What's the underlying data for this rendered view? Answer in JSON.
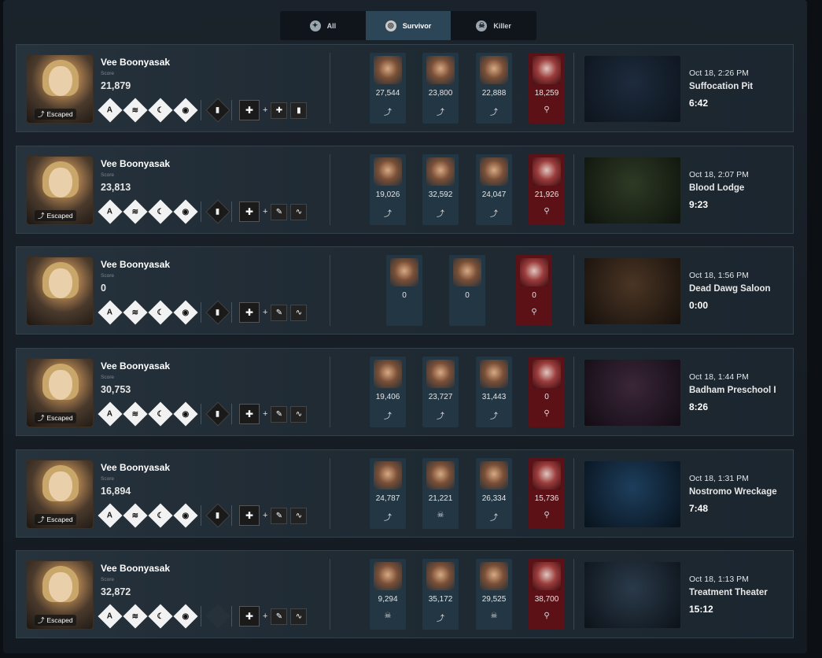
{
  "tabs": [
    {
      "label": "All",
      "icon": "palette-icon"
    },
    {
      "label": "Survivor",
      "icon": "survivor-icon",
      "active": true
    },
    {
      "label": "Killer",
      "icon": "killer-skull-icon"
    }
  ],
  "matches": [
    {
      "name": "Vee Boonyasak",
      "score_label": "Score",
      "score": "21,879",
      "status": "Escaped",
      "date": "Oct 18, 2:26 PM",
      "map": "Suffocation Pit",
      "duration": "6:42",
      "perks": [
        "A",
        "≋",
        "☾",
        "◉"
      ],
      "item_empty": false,
      "addons": [
        "✚",
        "▮"
      ],
      "map_colors": [
        "#1d2b3d",
        "#0d141c"
      ],
      "players": [
        {
          "score": "27,544",
          "status": "escaped-icon",
          "glyph": "⤴"
        },
        {
          "score": "23,800",
          "status": "escaped-icon",
          "glyph": "⤴"
        },
        {
          "score": "22,888",
          "status": "escaped-icon",
          "glyph": "⤴"
        },
        {
          "score": "18,259",
          "status": "hook-icon",
          "glyph": "⚲",
          "killer": true
        }
      ]
    },
    {
      "name": "Vee Boonyasak",
      "score_label": "Score",
      "score": "23,813",
      "status": "Escaped",
      "date": "Oct 18, 2:07 PM",
      "map": "Blood Lodge",
      "duration": "9:23",
      "perks": [
        "A",
        "≋",
        "☾",
        "◉"
      ],
      "item_empty": false,
      "addons": [
        "✎",
        "∿"
      ],
      "map_colors": [
        "#2e3a25",
        "#0e130c"
      ],
      "players": [
        {
          "score": "19,026",
          "status": "escaped-icon",
          "glyph": "⤴"
        },
        {
          "score": "32,592",
          "status": "escaped-icon",
          "glyph": "⤴"
        },
        {
          "score": "24,047",
          "status": "escaped-icon",
          "glyph": "⤴"
        },
        {
          "score": "21,926",
          "status": "hook-icon",
          "glyph": "⚲",
          "killer": true
        }
      ]
    },
    {
      "name": "Vee Boonyasak",
      "score_label": "Score",
      "score": "0",
      "status": "",
      "date": "Oct 18, 1:56 PM",
      "map": "Dead Dawg Saloon",
      "duration": "0:00",
      "perks": [
        "A",
        "≋",
        "☾",
        "◉"
      ],
      "item_empty": false,
      "addons": [
        "✎",
        "∿"
      ],
      "map_colors": [
        "#4a3524",
        "#16100b"
      ],
      "players": [
        {
          "score": "0",
          "status": "",
          "glyph": ""
        },
        {
          "score": "0",
          "status": "",
          "glyph": ""
        },
        {
          "score": "0",
          "status": "hook-icon",
          "glyph": "⚲",
          "killer": true
        }
      ]
    },
    {
      "name": "Vee Boonyasak",
      "score_label": "Score",
      "score": "30,753",
      "status": "Escaped",
      "date": "Oct 18, 1:44 PM",
      "map": "Badham Preschool I",
      "duration": "8:26",
      "perks": [
        "A",
        "≋",
        "☾",
        "◉"
      ],
      "item_empty": false,
      "addons": [
        "✎",
        "∿"
      ],
      "map_colors": [
        "#3a2638",
        "#120c14"
      ],
      "players": [
        {
          "score": "19,406",
          "status": "escaped-icon",
          "glyph": "⤴"
        },
        {
          "score": "23,727",
          "status": "escaped-icon",
          "glyph": "⤴"
        },
        {
          "score": "31,443",
          "status": "escaped-icon",
          "glyph": "⤴"
        },
        {
          "score": "0",
          "status": "hook-icon",
          "glyph": "⚲",
          "killer": true
        }
      ]
    },
    {
      "name": "Vee Boonyasak",
      "score_label": "Score",
      "score": "16,894",
      "status": "Escaped",
      "date": "Oct 18, 1:31 PM",
      "map": "Nostromo Wreckage",
      "duration": "7:48",
      "perks": [
        "A",
        "≋",
        "☾",
        "◉"
      ],
      "item_empty": false,
      "addons": [
        "✎",
        "∿"
      ],
      "map_colors": [
        "#1d3e5c",
        "#08121c"
      ],
      "players": [
        {
          "score": "24,787",
          "status": "escaped-icon",
          "glyph": "⤴"
        },
        {
          "score": "21,221",
          "status": "skull-icon",
          "glyph": "☠"
        },
        {
          "score": "26,334",
          "status": "escaped-icon",
          "glyph": "⤴"
        },
        {
          "score": "15,736",
          "status": "hook-icon",
          "glyph": "⚲",
          "killer": true
        }
      ]
    },
    {
      "name": "Vee Boonyasak",
      "score_label": "Score",
      "score": "32,872",
      "status": "Escaped",
      "date": "Oct 18, 1:13 PM",
      "map": "Treatment Theater",
      "duration": "15:12",
      "perks": [
        "A",
        "≋",
        "☾",
        "◉"
      ],
      "item_empty": true,
      "addons": [
        "✎",
        "∿"
      ],
      "map_colors": [
        "#2a3a4a",
        "#0c1218"
      ],
      "players": [
        {
          "score": "9,294",
          "status": "skull-icon",
          "glyph": "☠"
        },
        {
          "score": "35,172",
          "status": "escaped-icon",
          "glyph": "⤴"
        },
        {
          "score": "29,525",
          "status": "skull-icon",
          "glyph": "☠"
        },
        {
          "score": "38,700",
          "status": "hook-icon",
          "glyph": "⚲",
          "killer": true
        }
      ]
    }
  ]
}
